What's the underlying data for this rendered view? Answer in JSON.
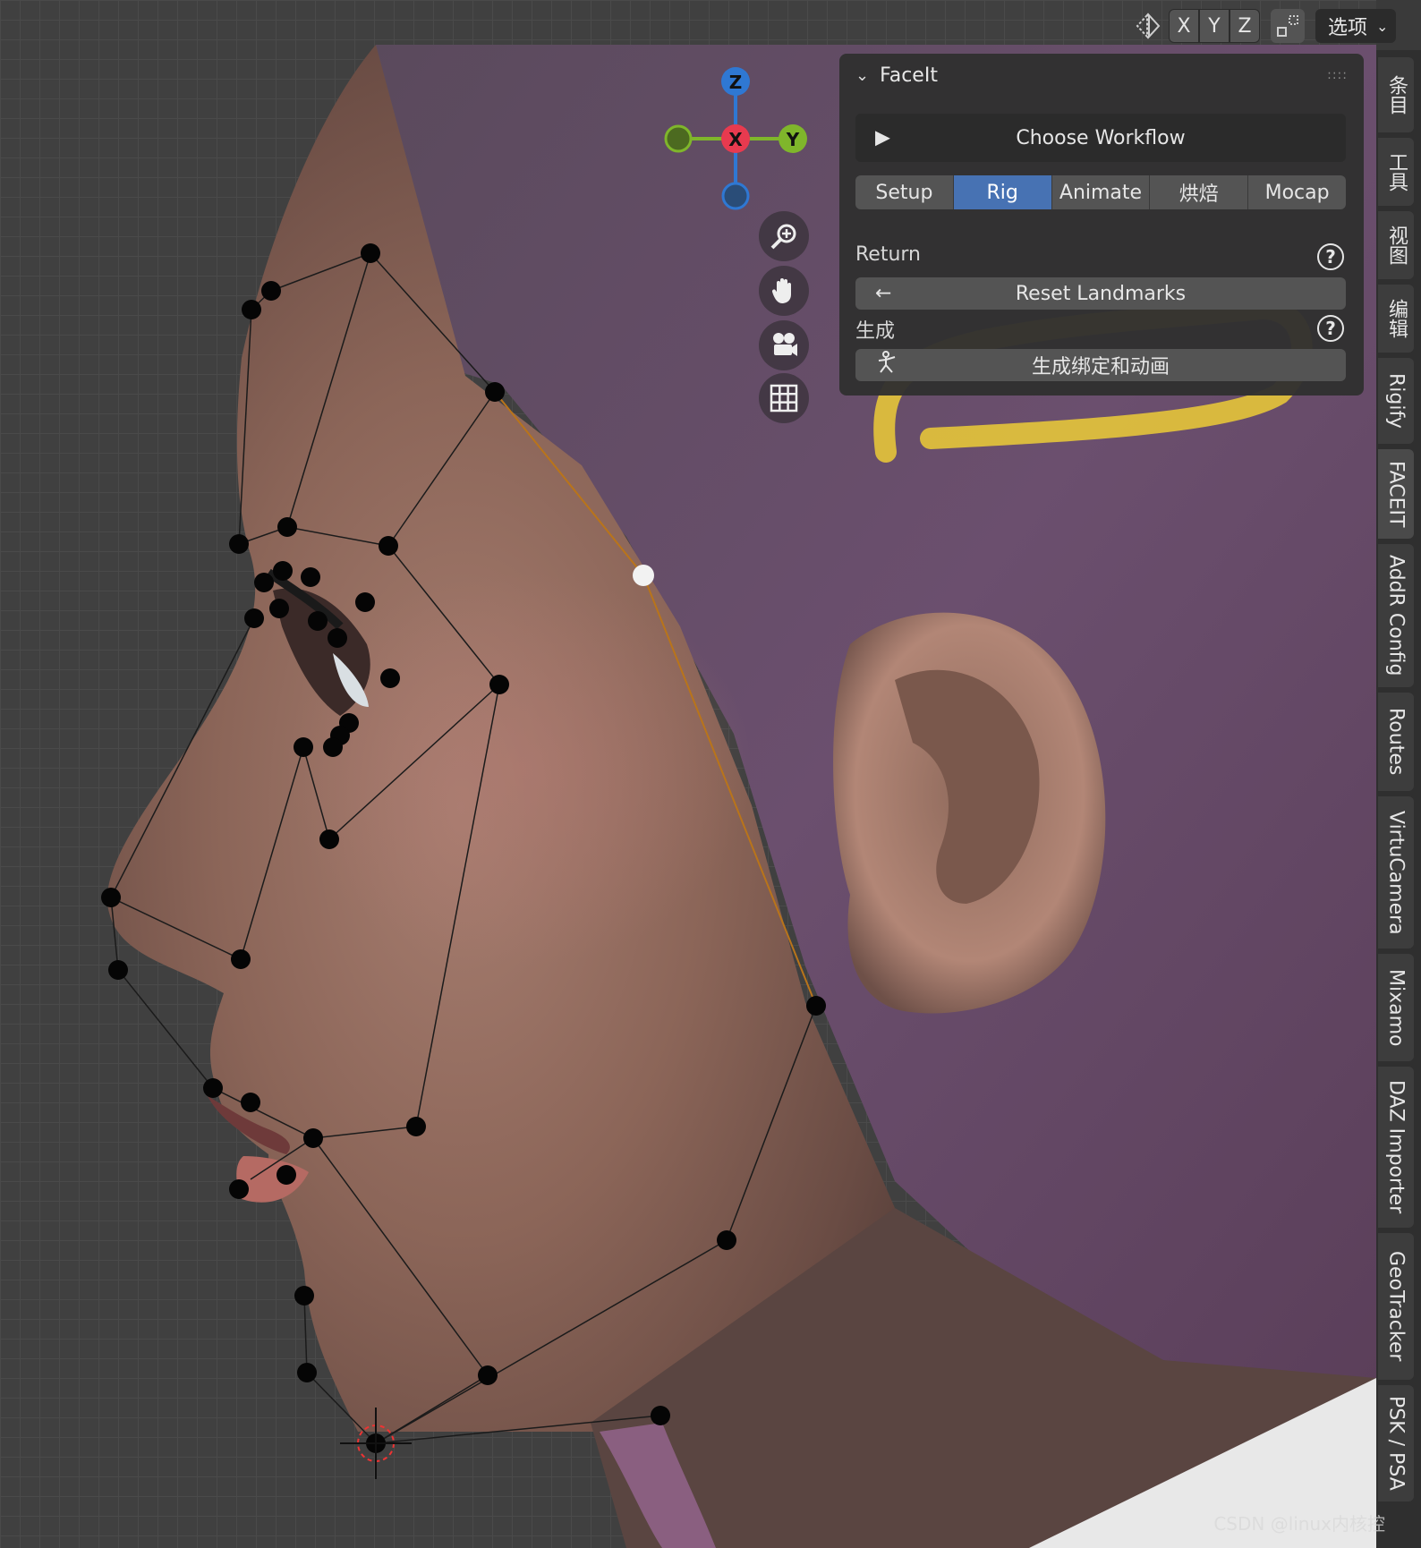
{
  "header": {
    "axes": [
      "X",
      "Y",
      "Z"
    ],
    "options_label": "选项"
  },
  "gizmo": {
    "z_label": "Z",
    "x_label": "X",
    "y_label": "Y"
  },
  "panel": {
    "title": "FaceIt",
    "choose_workflow": "Choose Workflow",
    "tabs": [
      "Setup",
      "Rig",
      "Animate",
      "烘焙",
      "Mocap"
    ],
    "active_tab": "Rig",
    "return_label": "Return",
    "reset_landmarks": "Reset Landmarks",
    "generate_label": "生成",
    "generate_rig_button": "生成绑定和动画"
  },
  "sidebar_tabs": [
    "条目",
    "工具",
    "视图",
    "编辑",
    "Rigify",
    "FACEIT",
    "AddR Config",
    "Routes",
    "VirtuCamera",
    "Mixamo",
    "DAZ Importer",
    "GeoTracker",
    "PSK / PSA"
  ],
  "active_sidebar_tab": "FACEIT",
  "watermark": "CSDN @linux内核控",
  "colors": {
    "active_tab": "#4772b3",
    "annotation_stroke": "#e6c53a",
    "landmark": "#000000",
    "landmark_selected": "#f2f2f2",
    "axis_x": "#e83a4f",
    "axis_y": "#7fb62b",
    "axis_z": "#2f78d3"
  }
}
